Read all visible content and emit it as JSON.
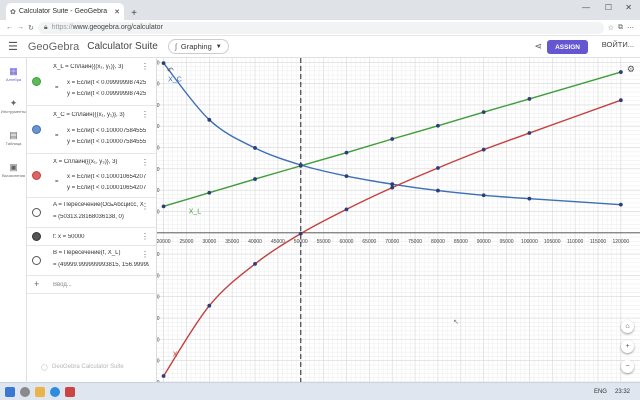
{
  "browser": {
    "tab_title": "Calculator Suite - GeoGebra",
    "new_tab": "+",
    "url_prefix": "https://",
    "url": "www.geogebra.org/calculator"
  },
  "app": {
    "brand": "GeoGebra",
    "suite": "Calculator Suite",
    "mode": "Graphing",
    "assign": "ASSIGN",
    "login": "ВОЙТИ...",
    "watermark": "GeoGebra Calculator Suite"
  },
  "rail": [
    {
      "label": "Алгебра",
      "icon": "calculator-icon"
    },
    {
      "label": "Инструменты",
      "icon": "tools-icon"
    },
    {
      "label": "Таблица",
      "icon": "table-icon"
    },
    {
      "label": "Вычисления",
      "icon": "cas-icon"
    }
  ],
  "algebra": {
    "rows": [
      {
        "id": "xl",
        "color": "#3f9e3a",
        "fill": "#5fb85a",
        "line1": "X_L = Сплайн({(x₁, y₁)}, 3)",
        "line2": "x = Если(t < 0.099999987425",
        "line3": "y = Если(t < 0.099999987425"
      },
      {
        "id": "xc",
        "color": "#3c6fb5",
        "fill": "#6a94cf",
        "line1": "X_C = Сплайн({(x₁, y₁)}, 3)",
        "line2": "x = Если(t < 0.100007584555",
        "line3": "y = Если(t < 0.100007584555"
      },
      {
        "id": "x",
        "color": "#c2413f",
        "fill": "#d96664",
        "line1": "X = Сплайн({(x₁, y₃)}, 3)",
        "line2": "x = Если(t < 0.100010654207",
        "line3": "y = Если(t < 0.100010654207"
      },
      {
        "id": "a",
        "color": "#555555",
        "fill": "#ffffff",
        "line1": "A = Пересечение(ОсьАбсцисс, X",
        "line2": "= (50313.2816803613​8, 0)"
      },
      {
        "id": "f",
        "color": "#333333",
        "fill": "#555555",
        "line1": "f: x = 50000"
      },
      {
        "id": "b",
        "color": "#555555",
        "fill": "#ffffff",
        "line1": "B = Пересечение(f, X_L)",
        "line2": "= (49999.999999993815, 156.99999"
      }
    ],
    "input_placeholder": "Ввод..."
  },
  "graph": {
    "labels": {
      "xc": "X_C",
      "xl": "X_L",
      "x": "X"
    },
    "x_ticks": [
      "20000",
      "25000",
      "30000",
      "35000",
      "40000",
      "45000",
      "50000",
      "55000",
      "60000",
      "65000",
      "70000",
      "75000",
      "80000",
      "85000",
      "90000",
      "95000",
      "100000",
      "105000",
      "110000",
      "115000",
      "120000"
    ],
    "y_ticks": [
      "400",
      "350",
      "300",
      "250",
      "200",
      "150",
      "100",
      "50",
      "-50",
      "-100",
      "-150",
      "-200",
      "-250",
      "-300",
      "-350"
    ]
  },
  "chart_data": {
    "type": "line",
    "xlim": [
      19000,
      122000
    ],
    "ylim": [
      -350,
      410
    ],
    "grid": true,
    "vertical_line_x": 50000,
    "series": [
      {
        "name": "X_L",
        "color": "#3f9e3a",
        "x": [
          20000,
          30000,
          40000,
          50000,
          60000,
          70000,
          80000,
          90000,
          100000,
          120000
        ],
        "y": [
          62,
          94,
          126,
          157,
          188,
          220,
          251,
          283,
          314,
          377
        ]
      },
      {
        "name": "X_C",
        "color": "#3c6fb5",
        "x": [
          20000,
          30000,
          40000,
          50000,
          60000,
          70000,
          80000,
          90000,
          100000,
          120000
        ],
        "y": [
          398,
          265,
          199,
          159,
          133,
          114,
          99,
          88,
          80,
          66
        ]
      },
      {
        "name": "X",
        "color": "#c2413f",
        "x": [
          20000,
          30000,
          40000,
          50000,
          60000,
          70000,
          80000,
          90000,
          100000,
          120000
        ],
        "y": [
          -336,
          -171,
          -73,
          -2,
          55,
          106,
          152,
          195,
          234,
          311
        ]
      }
    ]
  },
  "taskbar": {
    "lang": "ENG",
    "time": "23:32"
  }
}
